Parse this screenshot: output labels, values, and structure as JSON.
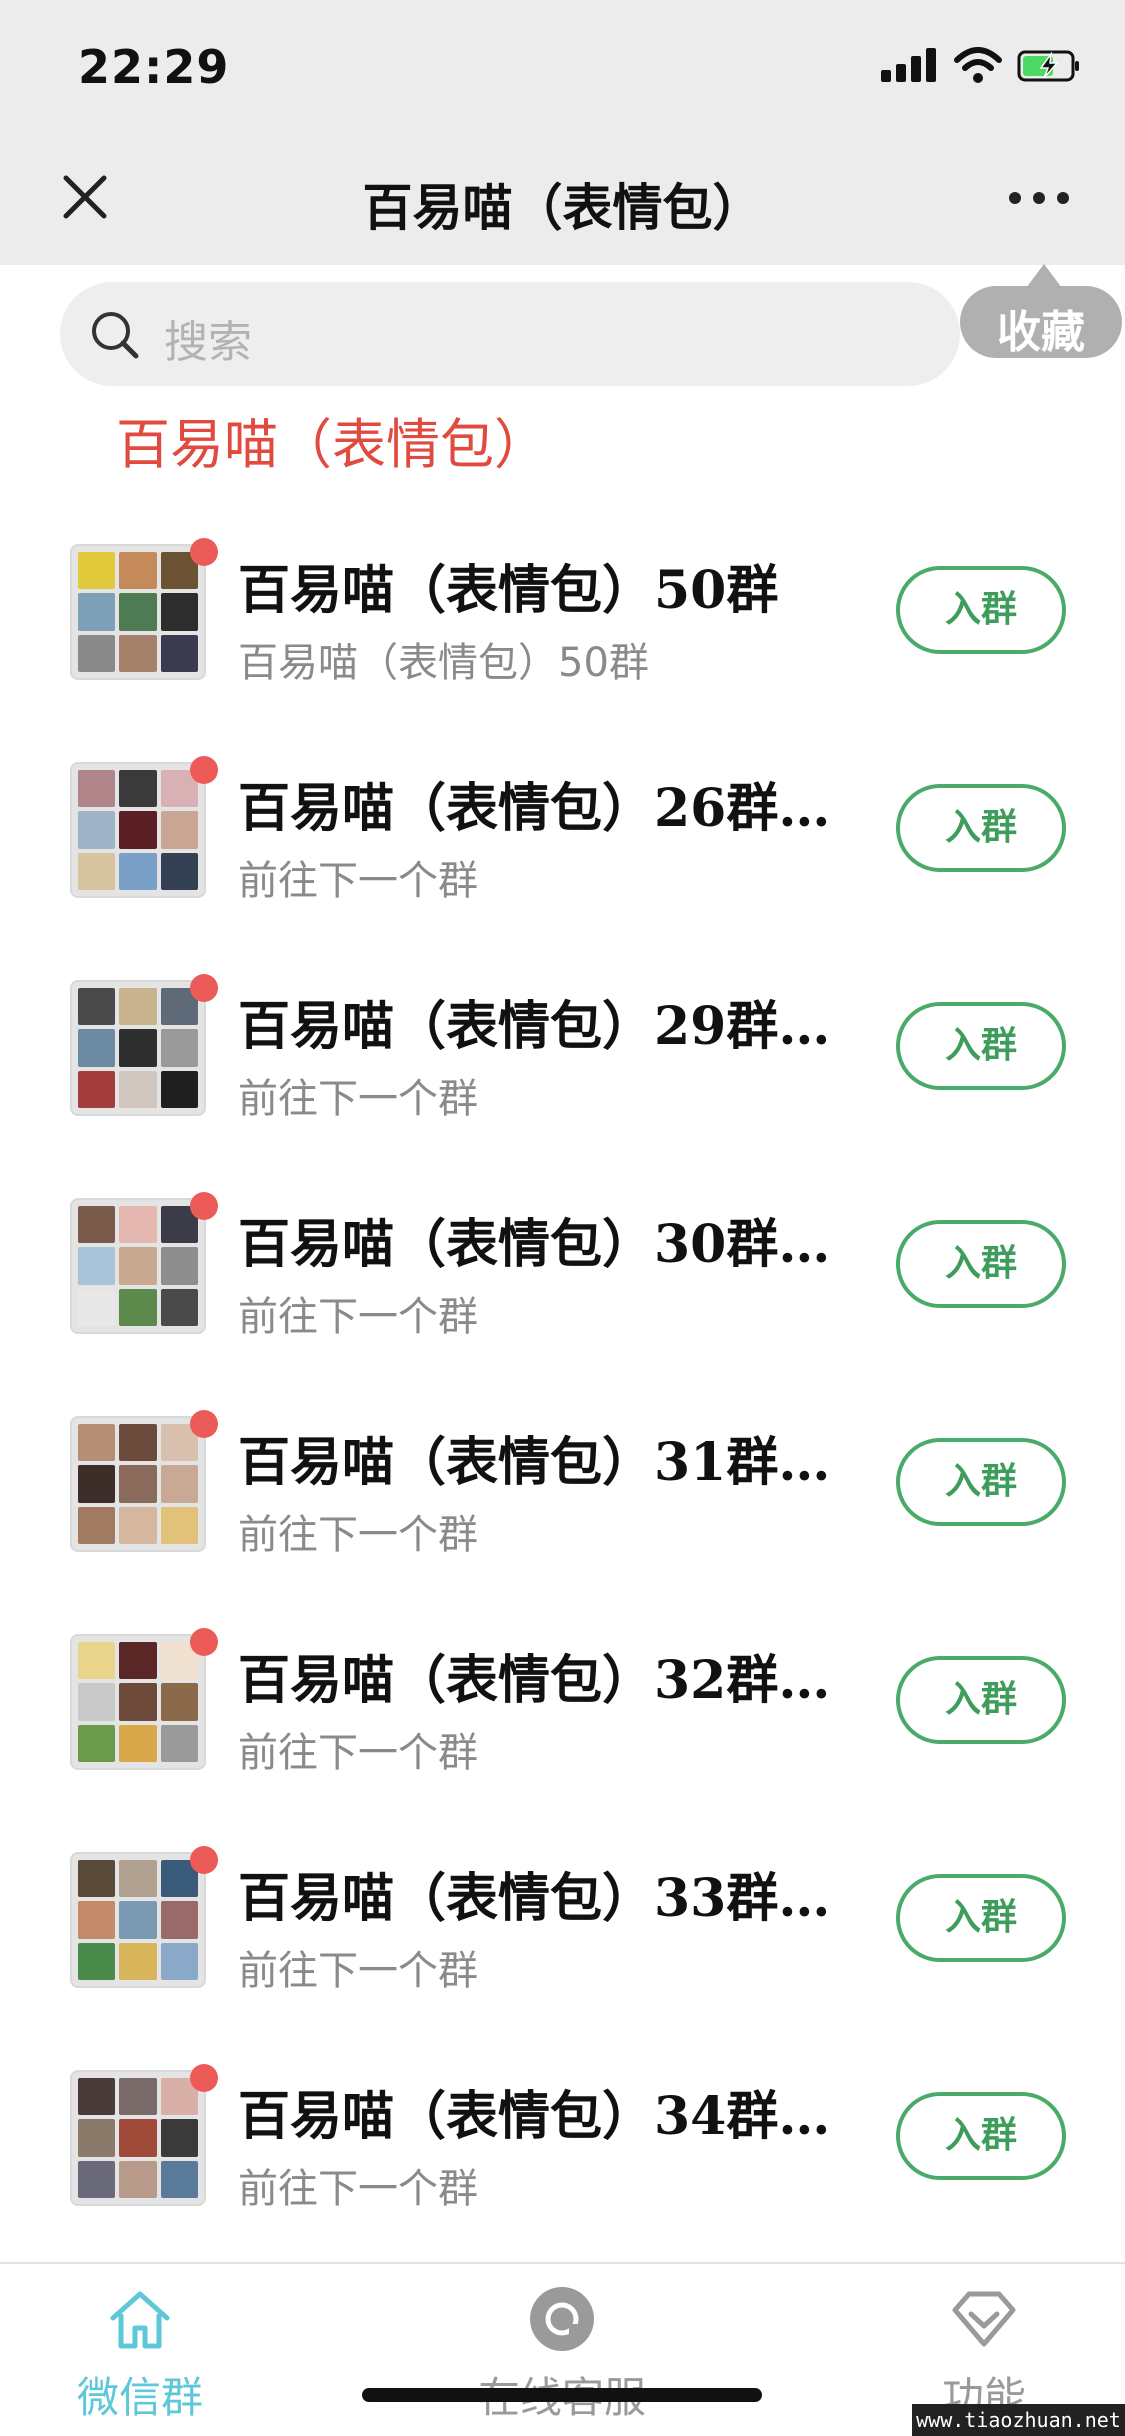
{
  "status_bar": {
    "time": "22:29"
  },
  "nav": {
    "title": "百易喵（表情包）"
  },
  "search": {
    "placeholder": "搜索"
  },
  "bookmark_tip": "收藏",
  "section_title": "百易喵（表情包）",
  "groups": [
    {
      "title": "百易喵（表情包）50群",
      "subtitle": "百易喵（表情包）50群",
      "button": "入群"
    },
    {
      "title": "百易喵（表情包）26群…",
      "subtitle": "前往下一个群",
      "button": "入群"
    },
    {
      "title": "百易喵（表情包）29群…",
      "subtitle": "前往下一个群",
      "button": "入群"
    },
    {
      "title": "百易喵（表情包）30群…",
      "subtitle": "前往下一个群",
      "button": "入群"
    },
    {
      "title": "百易喵（表情包）31群…",
      "subtitle": "前往下一个群",
      "button": "入群"
    },
    {
      "title": "百易喵（表情包）32群…",
      "subtitle": "前往下一个群",
      "button": "入群"
    },
    {
      "title": "百易喵（表情包）33群…",
      "subtitle": "前往下一个群",
      "button": "入群"
    },
    {
      "title": "百易喵（表情包）34群…",
      "subtitle": "前往下一个群",
      "button": "入群"
    }
  ],
  "tabs": [
    {
      "label": "微信群",
      "icon": "home-icon",
      "active": true
    },
    {
      "label": "在线客服",
      "icon": "service-icon",
      "active": false
    },
    {
      "label": "功能",
      "icon": "diamond-icon",
      "active": false
    }
  ],
  "watermark": "www.tiaozhuan.net",
  "colors": {
    "accent_green": "#4aaa68",
    "section_red": "#e04a3f",
    "active_tab": "#5ec8d8",
    "inactive_tab": "#9a9a9a",
    "badge_red": "#ec5b58"
  }
}
